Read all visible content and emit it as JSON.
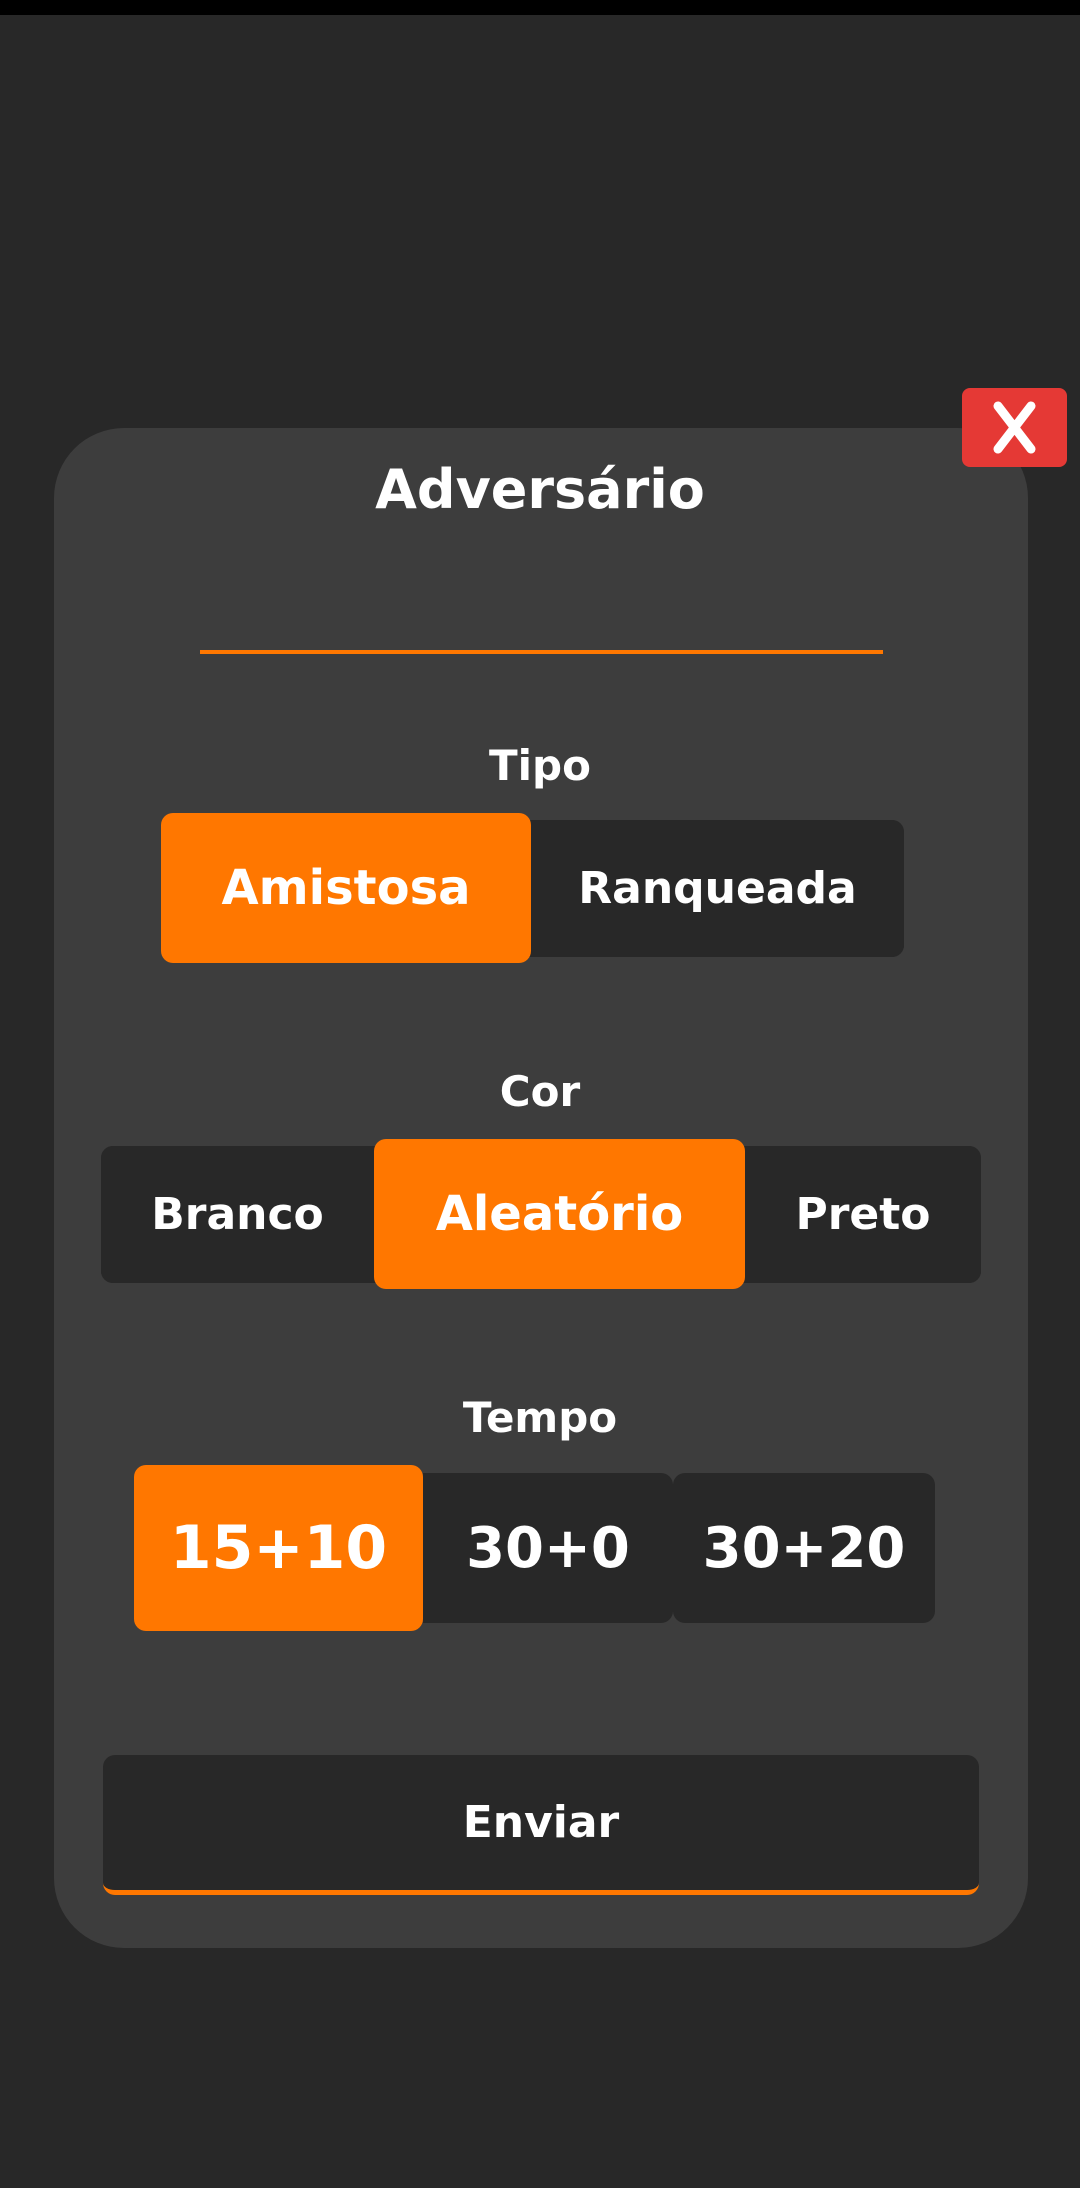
{
  "dialog": {
    "title": "Adversário",
    "opponent_input_value": "",
    "close_label": "X"
  },
  "tipo": {
    "label": "Tipo",
    "options": [
      "Amistosa",
      "Ranqueada"
    ],
    "selected": "Amistosa"
  },
  "cor": {
    "label": "Cor",
    "options": [
      "Branco",
      "Aleatório",
      "Preto"
    ],
    "selected": "Aleatório"
  },
  "tempo": {
    "label": "Tempo",
    "options": [
      "15+10",
      "30+0",
      "30+20"
    ],
    "selected": "15+10"
  },
  "submit": {
    "label": "Enviar"
  },
  "colors": {
    "background": "#282828",
    "dialog": "#3d3d3d",
    "accent": "#ff7700",
    "close": "#e53935"
  }
}
